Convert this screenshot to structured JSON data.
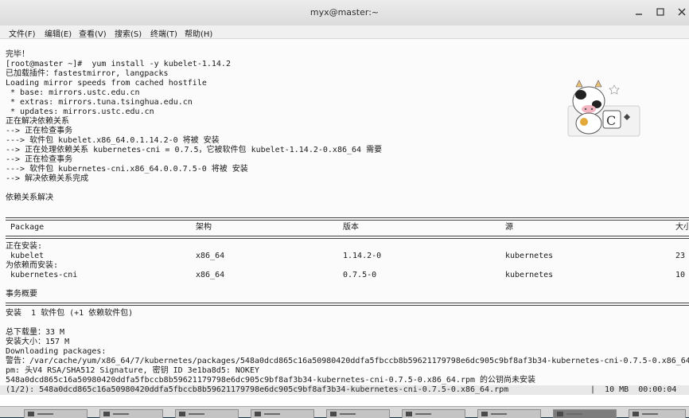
{
  "window": {
    "title": "myx@master:~",
    "minimize_icon": "minimize-icon",
    "maximize_icon": "maximize-icon",
    "close_icon": "close-icon"
  },
  "menu": [
    "文件(F)",
    "编辑(E)",
    "查看(V)",
    "搜索(S)",
    "终端(T)",
    "帮助(H)"
  ],
  "terminal": {
    "lines_top": [
      "完毕！",
      "[root@master ~]#  yum install -y kubelet-1.14.2",
      "已加载插件：fastestmirror, langpacks",
      "Loading mirror speeds from cached hostfile",
      " * base: mirrors.ustc.edu.cn",
      " * extras: mirrors.tuna.tsinghua.edu.cn",
      " * updates: mirrors.ustc.edu.cn",
      "正在解决依赖关系",
      "--> 正在检查事务",
      "---> 软件包 kubelet.x86_64.0.1.14.2-0 将被 安装",
      "--> 正在处理依赖关系 kubernetes-cni = 0.7.5，它被软件包 kubelet-1.14.2-0.x86_64 需要",
      "--> 正在检查事务",
      "---> 软件包 kubernetes-cni.x86_64.0.0.7.5-0 将被 安装",
      "--> 解决依赖关系完成",
      "",
      "依赖关系解决"
    ],
    "table": {
      "headers": [
        "Package",
        "架构",
        "版本",
        "源",
        "大小"
      ],
      "section_install": "正在安装:",
      "section_deps": "为依赖而安装:",
      "rows": [
        {
          "package": " kubelet",
          "arch": "x86_64",
          "version": "1.14.2-0",
          "repo": "kubernetes",
          "size": "23"
        },
        {
          "package": " kubernetes-cni",
          "arch": "x86_64",
          "version": "0.7.5-0",
          "repo": "kubernetes",
          "size": "10"
        }
      ]
    },
    "summary_title": "事务概要",
    "summary_line": "安装  1 软件包 (+1 依赖软件包)",
    "lines_bottom": [
      "总下载量：33 M",
      "安装大小：157 M",
      "Downloading packages:",
      "警告：/var/cache/yum/x86_64/7/kubernetes/packages/548a0dcd865c16a50980420ddfa5fbccb8b59621179798e6dc905c9bf8af3b34-kubernetes-cni-0.7.5-0.x86_64",
      "pm: 头V4 RSA/SHA512 Signature, 密钥 ID 3e1ba8d5: NOKEY",
      "548a0dcd865c16a50980420ddfa5fbccb8b59621179798e6dc905c9bf8af3b34-kubernetes-cni-0.7.5-0.x86_64.rpm 的公钥尚未安装"
    ],
    "progress_text": "(1/2): 548a0dcd865c16a50980420ddfa5fbccb8b59621179798e6dc905c9bf8af3b34-kubernetes-cni-0.7.5-0.x86_64.rpm",
    "progress_stats": "|  10 MB  00:00:04"
  },
  "mascot_icon": "cow-mascot-icon"
}
